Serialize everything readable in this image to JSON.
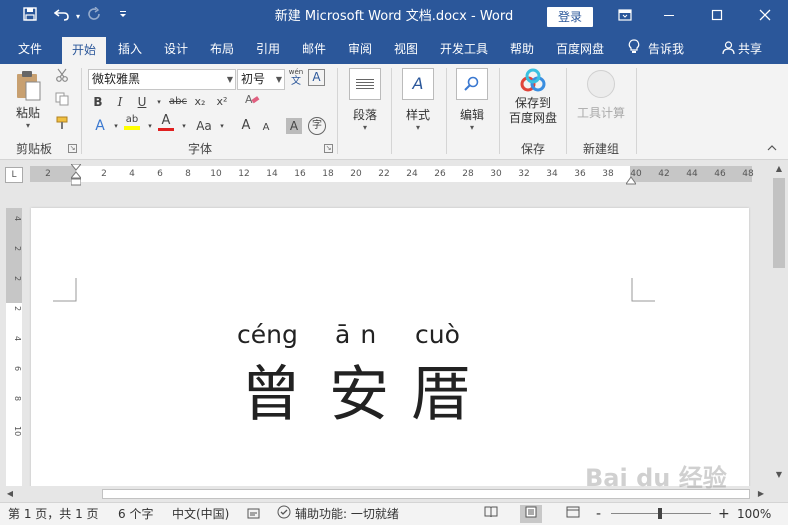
{
  "title_bar": {
    "document_title": "新建 Microsoft Word 文档.docx",
    "app_name": "Word",
    "login_label": "登录",
    "save_icon": "save-icon",
    "undo_icon": "undo-icon",
    "redo_icon": "redo-icon",
    "customize_icon": "customize-qat-icon"
  },
  "menu": {
    "tabs": [
      "文件",
      "开始",
      "插入",
      "设计",
      "布局",
      "引用",
      "邮件",
      "审阅",
      "视图",
      "开发工具",
      "帮助",
      "百度网盘"
    ],
    "active_tab": "开始",
    "tell_me": "告诉我",
    "share": "共享"
  },
  "ribbon": {
    "clipboard": {
      "paste": "粘贴",
      "group_label": "剪贴板"
    },
    "font": {
      "font_name": "微软雅黑",
      "font_size": "初号",
      "bold": "B",
      "italic": "I",
      "underline": "U",
      "strikethrough": "abc",
      "subscript": "x₂",
      "superscript": "x²",
      "change_case": "Aa",
      "grow": "A",
      "shrink": "A",
      "char_shading": "A",
      "enclose": "字",
      "phonetic": "wén",
      "phonetic_char": "文",
      "border": "A",
      "highlight": "ab",
      "font_color": "A",
      "text_effect": "A",
      "group_label": "字体"
    },
    "paragraph": {
      "label": "段落"
    },
    "styles": {
      "label": "样式"
    },
    "editing": {
      "label": "编辑"
    },
    "save": {
      "label_line1": "保存到",
      "label_line2": "百度网盘",
      "group_label": "保存"
    },
    "newgroup": {
      "tool_label": "工具计算",
      "group_label": "新建组"
    }
  },
  "ruler": {
    "h_ticks": [
      "2",
      "2",
      "4",
      "6",
      "8",
      "10",
      "12",
      "14",
      "16",
      "18",
      "20",
      "22",
      "24",
      "26",
      "28",
      "30",
      "32",
      "34",
      "36",
      "38",
      "40",
      "42",
      "44",
      "46",
      "48"
    ],
    "v_ticks": [
      "4",
      "2",
      "2",
      "2",
      "4",
      "6",
      "8",
      "10"
    ],
    "corner": "L"
  },
  "document": {
    "pinyin": [
      "céng",
      "ān",
      "cuò"
    ],
    "hanzi": [
      "曾",
      "安",
      "厝"
    ]
  },
  "status": {
    "page": "第 1 页，共 1 页",
    "words": "6 个字",
    "language": "中文(中国)",
    "accessibility": "辅助功能: 一切就绪",
    "zoom": "100%",
    "zoom_minus": "-",
    "zoom_plus": "+"
  },
  "watermark": "Bai du 经验"
}
